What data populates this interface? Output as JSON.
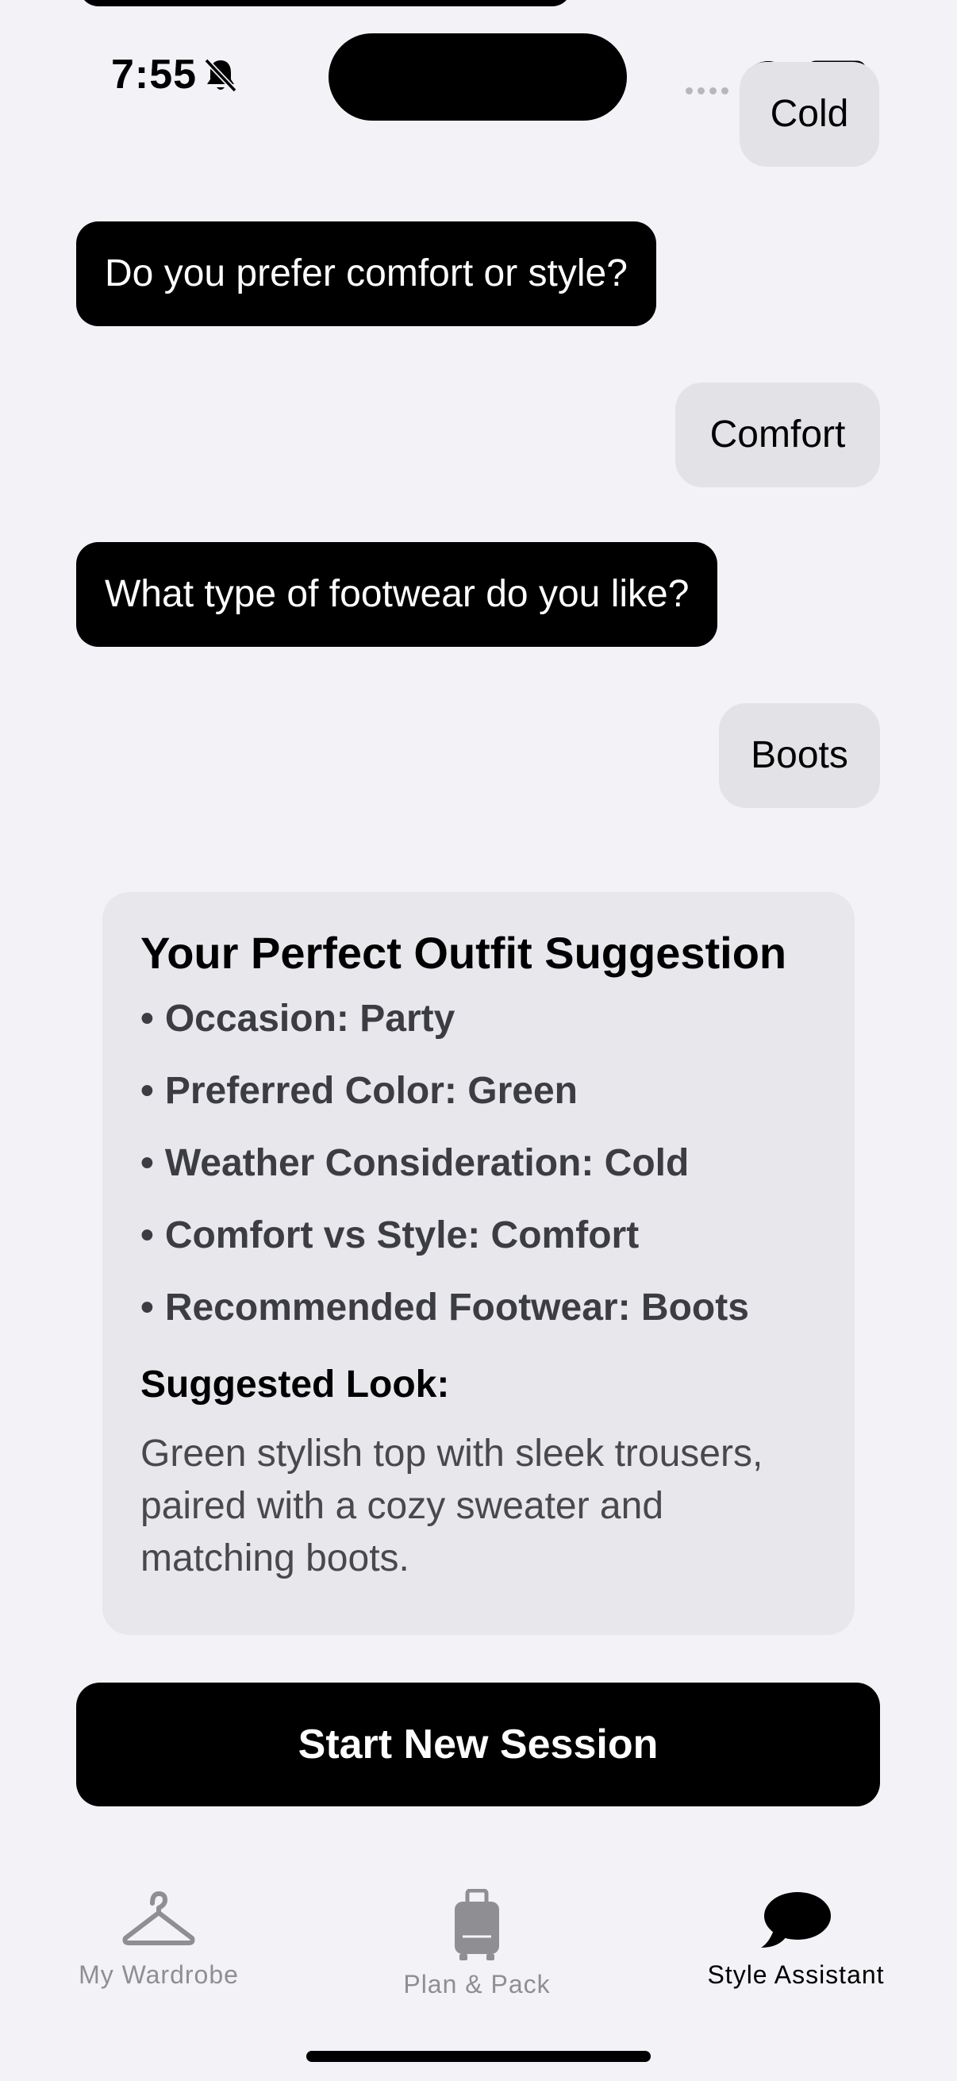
{
  "status_bar": {
    "time": "7:55"
  },
  "chat": {
    "messages": [
      {
        "role": "user",
        "text": "Cold"
      },
      {
        "role": "assistant",
        "text": "Do you prefer comfort or style?"
      },
      {
        "role": "user",
        "text": "Comfort"
      },
      {
        "role": "assistant",
        "text": "What type of footwear do you like?"
      },
      {
        "role": "user",
        "text": "Boots"
      }
    ]
  },
  "suggestion": {
    "title": "Your Perfect Outfit Suggestion",
    "bullet": "•",
    "items": [
      "Occasion: Party",
      "Preferred Color: Green",
      "Weather Consideration: Cold",
      "Comfort vs Style: Comfort",
      "Recommended Footwear: Boots"
    ],
    "subheading": "Suggested Look:",
    "description": "Green stylish top with sleek trousers, paired with a cozy sweater and matching boots."
  },
  "actions": {
    "start_new_session": "Start New Session"
  },
  "tab_bar": {
    "active_color": "#000000",
    "inactive_color": "#8e8e93",
    "tabs": [
      {
        "label": "My Wardrobe",
        "icon": "hanger-icon",
        "active": false
      },
      {
        "label": "Plan & Pack",
        "icon": "suitcase-icon",
        "active": false
      },
      {
        "label": "Style Assistant",
        "icon": "chat-bubble-icon",
        "active": true
      }
    ]
  }
}
